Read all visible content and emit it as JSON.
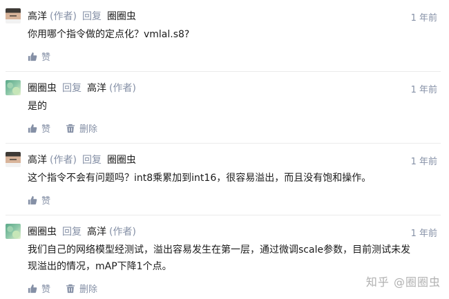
{
  "comments": [
    {
      "author": "高洋",
      "author_tag": "(作者)",
      "reply_label": "回复",
      "reply_to": "圈圈虫",
      "reply_to_tag": "",
      "time": "1 年前",
      "text": "你用哪个指令做的定点化？vmlal.s8?",
      "like_label": "赞",
      "delete_label": ""
    },
    {
      "author": "圈圈虫",
      "author_tag": "",
      "reply_label": "回复",
      "reply_to": "高洋",
      "reply_to_tag": "(作者)",
      "time": "1 年前",
      "text": "是的",
      "like_label": "赞",
      "delete_label": "删除"
    },
    {
      "author": "高洋",
      "author_tag": "(作者)",
      "reply_label": "回复",
      "reply_to": "圈圈虫",
      "reply_to_tag": "",
      "time": "1 年前",
      "text": "这个指令不会有问题吗？int8乘累加到int16，很容易溢出，而且没有饱和操作。",
      "like_label": "赞",
      "delete_label": ""
    },
    {
      "author": "圈圈虫",
      "author_tag": "",
      "reply_label": "回复",
      "reply_to": "高洋",
      "reply_to_tag": "(作者)",
      "time": "1 年前",
      "text_line1": "我们自己的网络模型经测试，溢出容易发生在第一层，通过微调scale参数，目前测试未发",
      "text_line2": "现溢出的情况，mAP下降1个点。",
      "like_label": "赞",
      "delete_label": "删除"
    }
  ],
  "watermark": "知乎 @圈圈虫"
}
